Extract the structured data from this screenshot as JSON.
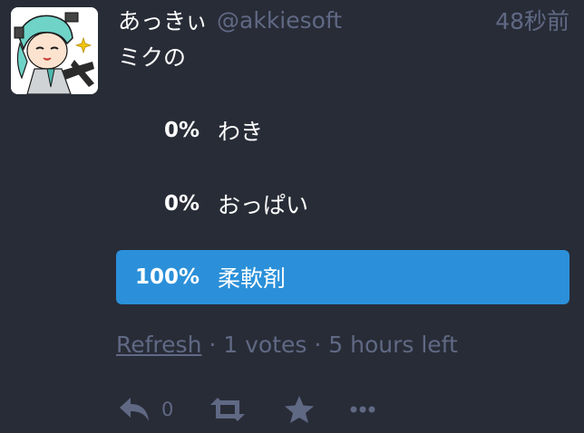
{
  "author": {
    "display_name": "あっきぃ",
    "acct": "@akkiesoft",
    "avatar": "avatar-image"
  },
  "time": "48秒前",
  "content": "ミクの",
  "poll": {
    "options": [
      {
        "percent_label": "0%",
        "label": "わき",
        "fraction": 0.0,
        "leading": false
      },
      {
        "percent_label": "0%",
        "label": "おっぱい",
        "fraction": 0.0,
        "leading": false
      },
      {
        "percent_label": "100%",
        "label": "柔軟剤",
        "fraction": 1.0,
        "leading": true
      }
    ],
    "footer": {
      "refresh_label": "Refresh",
      "separator_1": " · ",
      "votes": "1 votes",
      "separator_2": " · ",
      "time_left": "5 hours left"
    }
  },
  "actions": {
    "reply_count": "0",
    "icons": [
      "reply-icon",
      "boost-icon",
      "favourite-icon",
      "more-icon"
    ]
  },
  "colors": {
    "background": "#282c37",
    "muted": "#606984",
    "accent": "#2b90d9",
    "text": "#ffffff"
  }
}
